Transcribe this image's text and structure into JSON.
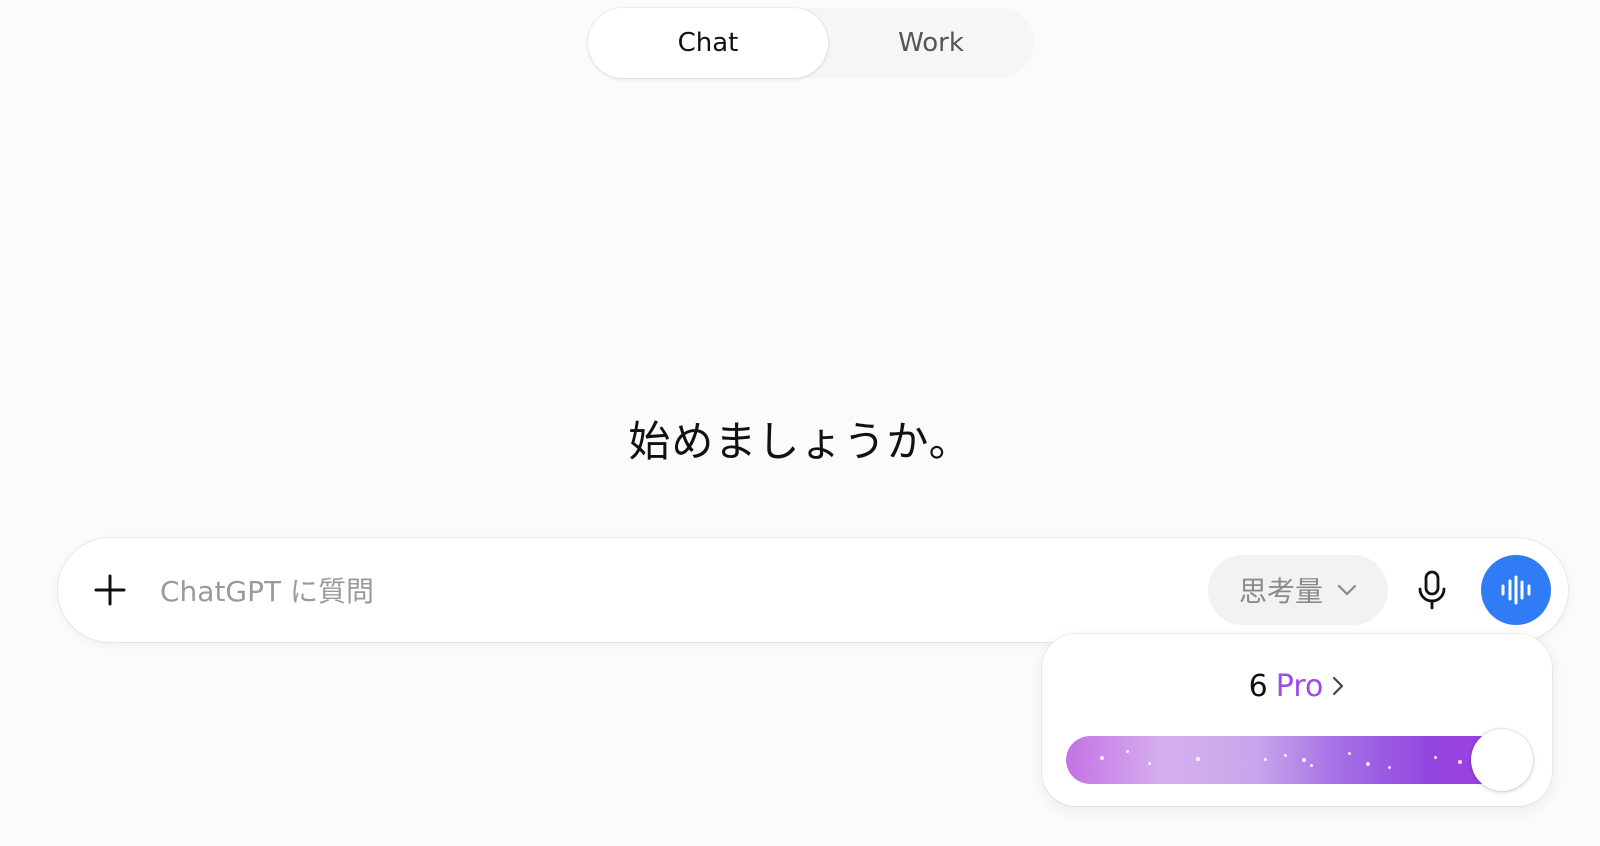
{
  "mode_switch": {
    "tabs": [
      {
        "label": "Chat",
        "selected": true
      },
      {
        "label": "Work",
        "selected": false
      }
    ]
  },
  "greeting": "始めましょうか。",
  "composer": {
    "plus_icon": "plus-icon",
    "value": "",
    "placeholder": "ChatGPT に質問",
    "thinking_button": {
      "label": "思考量",
      "icon": "chevron-down-icon"
    },
    "mic_icon": "microphone-icon",
    "voice_icon": "voice-waveform-icon"
  },
  "thinking_popover": {
    "level_number": "6",
    "level_name": "Pro",
    "chevron_icon": "chevron-right-icon",
    "slider_level": 1.0
  },
  "colors": {
    "voice_button": "#2f7cf6",
    "pro_accent": "#9b4be8",
    "slider_start": "#c472e6",
    "slider_end": "#a33ee6"
  }
}
